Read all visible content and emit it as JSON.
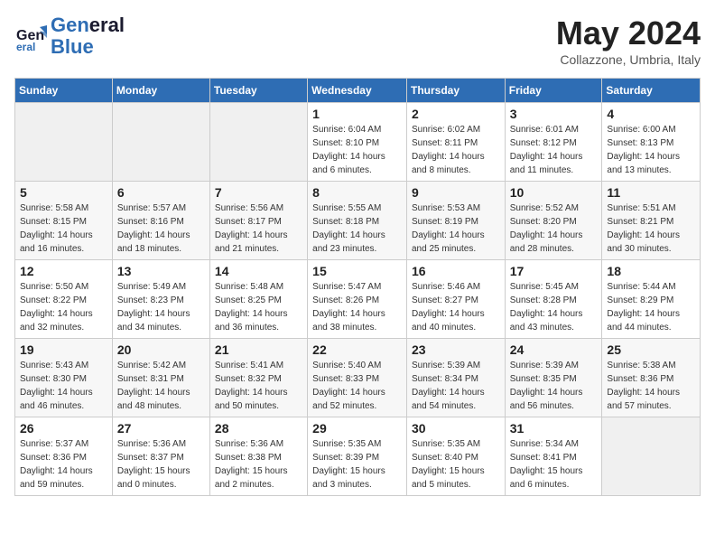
{
  "header": {
    "logo_line1": "General",
    "logo_line2": "Blue",
    "month_title": "May 2024",
    "location": "Collazzone, Umbria, Italy"
  },
  "days_of_week": [
    "Sunday",
    "Monday",
    "Tuesday",
    "Wednesday",
    "Thursday",
    "Friday",
    "Saturday"
  ],
  "weeks": [
    [
      {
        "day": "",
        "info": ""
      },
      {
        "day": "",
        "info": ""
      },
      {
        "day": "",
        "info": ""
      },
      {
        "day": "1",
        "info": "Sunrise: 6:04 AM\nSunset: 8:10 PM\nDaylight: 14 hours\nand 6 minutes."
      },
      {
        "day": "2",
        "info": "Sunrise: 6:02 AM\nSunset: 8:11 PM\nDaylight: 14 hours\nand 8 minutes."
      },
      {
        "day": "3",
        "info": "Sunrise: 6:01 AM\nSunset: 8:12 PM\nDaylight: 14 hours\nand 11 minutes."
      },
      {
        "day": "4",
        "info": "Sunrise: 6:00 AM\nSunset: 8:13 PM\nDaylight: 14 hours\nand 13 minutes."
      }
    ],
    [
      {
        "day": "5",
        "info": "Sunrise: 5:58 AM\nSunset: 8:15 PM\nDaylight: 14 hours\nand 16 minutes."
      },
      {
        "day": "6",
        "info": "Sunrise: 5:57 AM\nSunset: 8:16 PM\nDaylight: 14 hours\nand 18 minutes."
      },
      {
        "day": "7",
        "info": "Sunrise: 5:56 AM\nSunset: 8:17 PM\nDaylight: 14 hours\nand 21 minutes."
      },
      {
        "day": "8",
        "info": "Sunrise: 5:55 AM\nSunset: 8:18 PM\nDaylight: 14 hours\nand 23 minutes."
      },
      {
        "day": "9",
        "info": "Sunrise: 5:53 AM\nSunset: 8:19 PM\nDaylight: 14 hours\nand 25 minutes."
      },
      {
        "day": "10",
        "info": "Sunrise: 5:52 AM\nSunset: 8:20 PM\nDaylight: 14 hours\nand 28 minutes."
      },
      {
        "day": "11",
        "info": "Sunrise: 5:51 AM\nSunset: 8:21 PM\nDaylight: 14 hours\nand 30 minutes."
      }
    ],
    [
      {
        "day": "12",
        "info": "Sunrise: 5:50 AM\nSunset: 8:22 PM\nDaylight: 14 hours\nand 32 minutes."
      },
      {
        "day": "13",
        "info": "Sunrise: 5:49 AM\nSunset: 8:23 PM\nDaylight: 14 hours\nand 34 minutes."
      },
      {
        "day": "14",
        "info": "Sunrise: 5:48 AM\nSunset: 8:25 PM\nDaylight: 14 hours\nand 36 minutes."
      },
      {
        "day": "15",
        "info": "Sunrise: 5:47 AM\nSunset: 8:26 PM\nDaylight: 14 hours\nand 38 minutes."
      },
      {
        "day": "16",
        "info": "Sunrise: 5:46 AM\nSunset: 8:27 PM\nDaylight: 14 hours\nand 40 minutes."
      },
      {
        "day": "17",
        "info": "Sunrise: 5:45 AM\nSunset: 8:28 PM\nDaylight: 14 hours\nand 43 minutes."
      },
      {
        "day": "18",
        "info": "Sunrise: 5:44 AM\nSunset: 8:29 PM\nDaylight: 14 hours\nand 44 minutes."
      }
    ],
    [
      {
        "day": "19",
        "info": "Sunrise: 5:43 AM\nSunset: 8:30 PM\nDaylight: 14 hours\nand 46 minutes."
      },
      {
        "day": "20",
        "info": "Sunrise: 5:42 AM\nSunset: 8:31 PM\nDaylight: 14 hours\nand 48 minutes."
      },
      {
        "day": "21",
        "info": "Sunrise: 5:41 AM\nSunset: 8:32 PM\nDaylight: 14 hours\nand 50 minutes."
      },
      {
        "day": "22",
        "info": "Sunrise: 5:40 AM\nSunset: 8:33 PM\nDaylight: 14 hours\nand 52 minutes."
      },
      {
        "day": "23",
        "info": "Sunrise: 5:39 AM\nSunset: 8:34 PM\nDaylight: 14 hours\nand 54 minutes."
      },
      {
        "day": "24",
        "info": "Sunrise: 5:39 AM\nSunset: 8:35 PM\nDaylight: 14 hours\nand 56 minutes."
      },
      {
        "day": "25",
        "info": "Sunrise: 5:38 AM\nSunset: 8:36 PM\nDaylight: 14 hours\nand 57 minutes."
      }
    ],
    [
      {
        "day": "26",
        "info": "Sunrise: 5:37 AM\nSunset: 8:36 PM\nDaylight: 14 hours\nand 59 minutes."
      },
      {
        "day": "27",
        "info": "Sunrise: 5:36 AM\nSunset: 8:37 PM\nDaylight: 15 hours\nand 0 minutes."
      },
      {
        "day": "28",
        "info": "Sunrise: 5:36 AM\nSunset: 8:38 PM\nDaylight: 15 hours\nand 2 minutes."
      },
      {
        "day": "29",
        "info": "Sunrise: 5:35 AM\nSunset: 8:39 PM\nDaylight: 15 hours\nand 3 minutes."
      },
      {
        "day": "30",
        "info": "Sunrise: 5:35 AM\nSunset: 8:40 PM\nDaylight: 15 hours\nand 5 minutes."
      },
      {
        "day": "31",
        "info": "Sunrise: 5:34 AM\nSunset: 8:41 PM\nDaylight: 15 hours\nand 6 minutes."
      },
      {
        "day": "",
        "info": ""
      }
    ]
  ]
}
